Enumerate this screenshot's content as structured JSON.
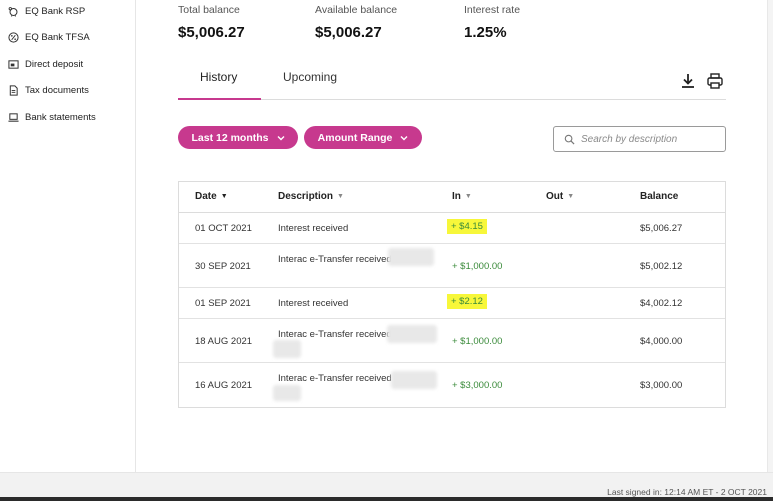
{
  "sidebar": {
    "items": [
      {
        "label": "EQ Bank RSP",
        "icon": "piggy-bank-icon"
      },
      {
        "label": "EQ Bank TFSA",
        "icon": "percent-circle-icon"
      },
      {
        "label": "Direct deposit",
        "icon": "deposit-card-icon"
      },
      {
        "label": "Tax documents",
        "icon": "document-icon"
      },
      {
        "label": "Bank statements",
        "icon": "laptop-icon"
      }
    ]
  },
  "summary": {
    "total_balance_label": "Total balance",
    "total_balance": "$5,006.27",
    "available_balance_label": "Available balance",
    "available_balance": "$5,006.27",
    "interest_rate_label": "Interest rate",
    "interest_rate": "1.25%"
  },
  "tabs": {
    "history": "History",
    "upcoming": "Upcoming",
    "active": "History"
  },
  "toolbar": {
    "download_icon": "download-icon",
    "print_icon": "printer-icon"
  },
  "filters": {
    "date_range": "Last 12 months",
    "amount_range": "Amount Range",
    "search_placeholder": "Search by description"
  },
  "table": {
    "headers": {
      "date": "Date",
      "description": "Description",
      "in": "In",
      "out": "Out",
      "balance": "Balance"
    },
    "rows": [
      {
        "date": "01 OCT 2021",
        "description": "Interest received",
        "in": "+ $4.15",
        "out": "",
        "balance": "$5,006.27"
      },
      {
        "date": "30 SEP 2021",
        "description": "Interac e-Transfer received",
        "in": "+ $1,000.00",
        "out": "",
        "balance": "$5,002.12"
      },
      {
        "date": "01 SEP 2021",
        "description": "Interest received",
        "in": "+ $2.12",
        "out": "",
        "balance": "$4,002.12"
      },
      {
        "date": "18 AUG 2021",
        "description": "Interac e-Transfer received",
        "in": "+ $1,000.00",
        "out": "",
        "balance": "$4,000.00"
      },
      {
        "date": "16 AUG 2021",
        "description": "Interac e-Transfer received",
        "in": "+ $3,000.00",
        "out": "",
        "balance": "$3,000.00"
      }
    ]
  },
  "footer": {
    "last_signed_in": "Last signed in: 12:14 AM ET - 2 OCT 2021"
  },
  "colors": {
    "accent": "#c7398e",
    "credit_green": "#3b8b3b",
    "highlight": "#f7f73a"
  }
}
